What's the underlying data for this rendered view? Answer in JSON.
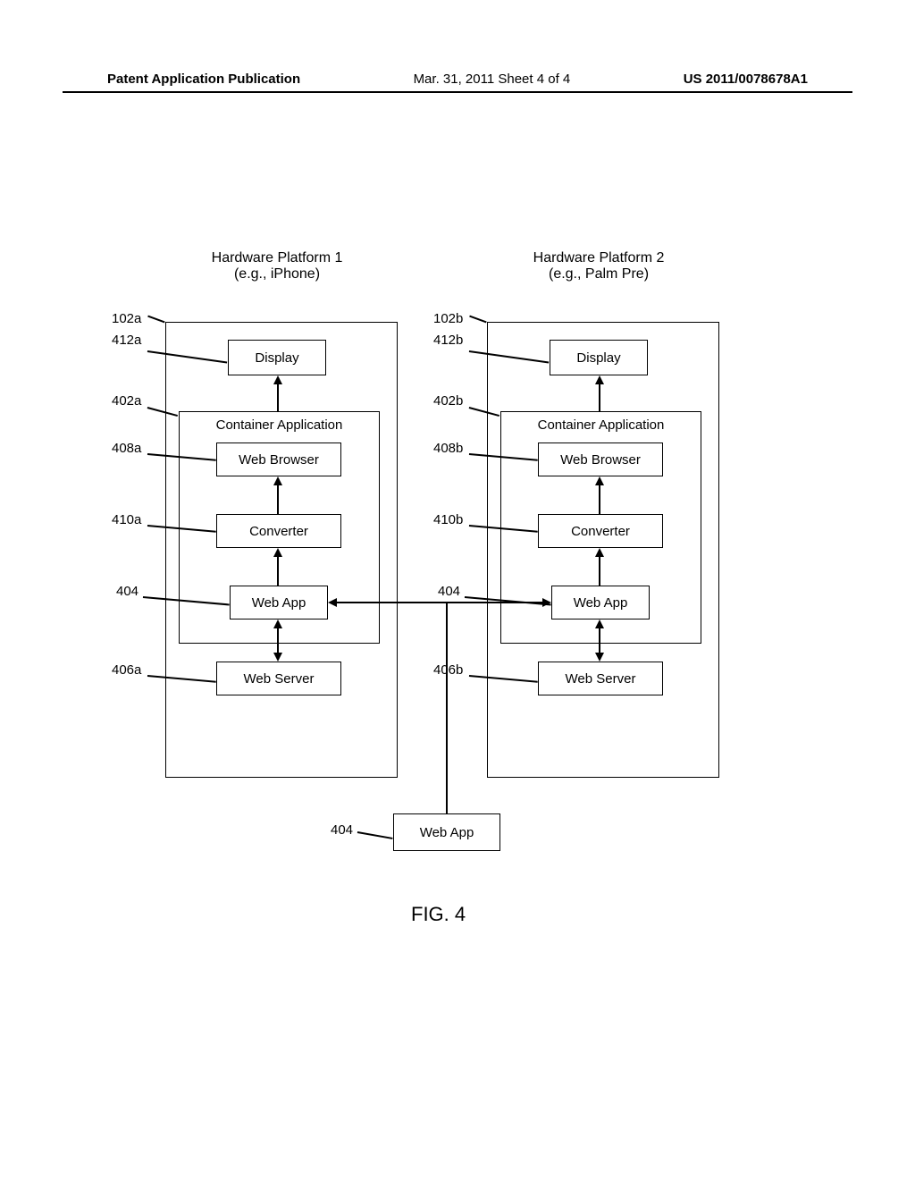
{
  "header": {
    "left": "Patent Application Publication",
    "mid": "Mar. 31, 2011  Sheet 4 of 4",
    "right": "US 2011/0078678A1"
  },
  "platforms": {
    "a": {
      "title_line1": "Hardware Platform 1",
      "title_line2": "(e.g., iPhone)"
    },
    "b": {
      "title_line1": "Hardware Platform 2",
      "title_line2": "(e.g., Palm Pre)"
    }
  },
  "boxes": {
    "display": "Display",
    "container_app": "Container Application",
    "web_browser": "Web Browser",
    "converter": "Converter",
    "web_app": "Web App",
    "web_server": "Web Server"
  },
  "refs": {
    "r102a": "102a",
    "r412a": "412a",
    "r402a": "402a",
    "r408a": "408a",
    "r410a": "410a",
    "r404a": "404",
    "r406a": "406a",
    "r102b": "102b",
    "r412b": "412b",
    "r402b": "402b",
    "r408b": "408b",
    "r410b": "410b",
    "r404b": "404",
    "r406b": "406b",
    "r404c": "404"
  },
  "figure_label": "FIG. 4"
}
